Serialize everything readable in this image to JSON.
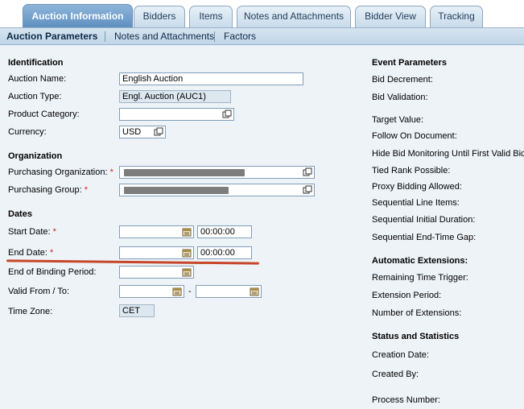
{
  "tabs": [
    {
      "label": "Auction Information",
      "active": true
    },
    {
      "label": "Bidders"
    },
    {
      "label": "Items"
    },
    {
      "label": "Notes and Attachments"
    },
    {
      "label": "Bidder View"
    },
    {
      "label": "Tracking"
    }
  ],
  "subnav": [
    "Auction Parameters",
    "Notes and Attachments",
    "Factors"
  ],
  "identification": {
    "heading": "Identification",
    "auction_name_label": "Auction Name:",
    "auction_name_value": "English Auction",
    "auction_type_label": "Auction Type:",
    "auction_type_value": "Engl. Auction (AUC1)",
    "product_category_label": "Product Category:",
    "product_category_value": "",
    "currency_label": "Currency:",
    "currency_value": "USD"
  },
  "organization": {
    "heading": "Organization",
    "purch_org_label": "Purchasing Organization:",
    "purch_group_label": "Purchasing Group:",
    "required_mark": "*"
  },
  "dates": {
    "heading": "Dates",
    "start_date_label": "Start Date:",
    "start_time": "00:00:00",
    "end_date_label": "End Date:",
    "end_time": "00:00:00",
    "binding_label": "End of Binding Period:",
    "valid_label": "Valid From / To:",
    "range_sep": "-",
    "timezone_label": "Time Zone:",
    "timezone_value": "CET"
  },
  "event_parameters": {
    "heading": "Event Parameters",
    "items": [
      "Bid Decrement:",
      "Bid Validation:",
      "Target Value:",
      "Follow On Document:",
      "Hide Bid Monitoring Until First Valid Bid:",
      "Tied Rank Possible:",
      "Proxy Bidding Allowed:",
      "Sequential Line Items:",
      "Sequential Initial Duration:",
      "Sequential End-Time Gap:"
    ]
  },
  "automatic_extensions": {
    "heading": "Automatic Extensions:",
    "items": [
      "Remaining Time Trigger:",
      "Extension Period:",
      "Number of Extensions:"
    ]
  },
  "status": {
    "heading": "Status and Statistics",
    "items": [
      "Creation Date:",
      "Created By:",
      "Process Number:"
    ]
  },
  "colors": {
    "accent": "#5f8fbf",
    "required": "#d21e1e",
    "annotation": "#c7462a"
  }
}
